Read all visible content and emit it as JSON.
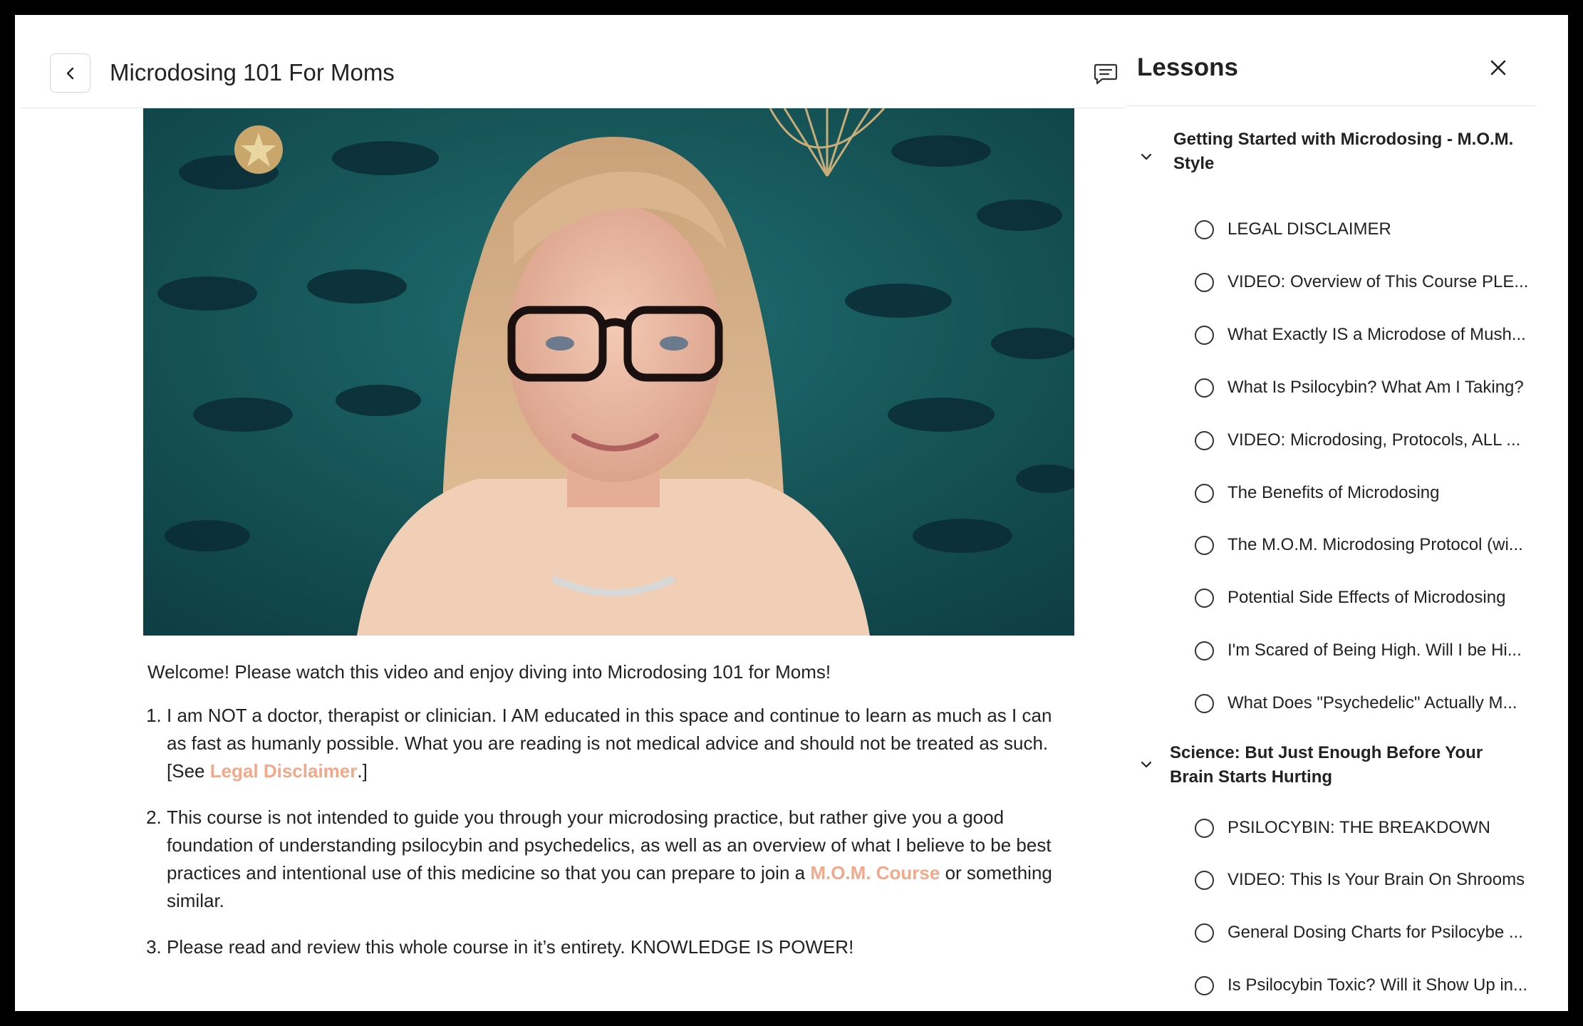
{
  "header": {
    "course_title": "Microdosing 101 For Moms"
  },
  "content": {
    "welcome": "Welcome! Please watch this video and enjoy diving into Microdosing 101 for Moms!",
    "item1_text": "I am NOT a doctor, therapist or clinician. I AM educated in this space and continue to learn as much as I can as fast as humanly possible. What you are reading is not medical advice and should not be treated as such. [See ",
    "item1_link": "Legal Disclaimer",
    "item1_end": ".]",
    "item2_text": "This course is not intended to guide you through your microdosing practice, but rather give you a good foundation of understanding psilocybin and psychedelics, as well as an overview of what I believe to be best practices and intentional use of this medicine so that you can prepare to join a ",
    "item2_link": "M.O.M. Course",
    "item2_end": " or something similar.",
    "item3_text": "Please read and review this whole course in it’s entirety. KNOWLEDGE IS POWER!"
  },
  "sidebar": {
    "title": "Lessons",
    "sections": [
      {
        "title": "Getting Started with Microdosing - M.O.M. Style",
        "lessons": [
          "LEGAL DISCLAIMER",
          "VIDEO: Overview of This Course PLE...",
          "What Exactly IS a Microdose of Mush...",
          "What Is Psilocybin? What Am I Taking?",
          "VIDEO: Microdosing, Protocols, ALL ...",
          "The Benefits of Microdosing",
          "The M.O.M. Microdosing Protocol (wi...",
          "Potential Side Effects of Microdosing",
          "I'm Scared of Being High. Will I be Hi...",
          "What Does \"Psychedelic\" Actually M..."
        ]
      },
      {
        "title": "Science: But Just Enough Before Your Brain Starts Hurting",
        "lessons": [
          "PSILOCYBIN: THE BREAKDOWN",
          "VIDEO: This Is Your Brain On Shrooms",
          "General Dosing Charts for Psilocybe ...",
          "Is Psilocybin Toxic? Will it Show Up in..."
        ]
      }
    ]
  },
  "colors": {
    "link": "#f0a98a",
    "video_bg": "#14585a",
    "text": "#222222"
  }
}
